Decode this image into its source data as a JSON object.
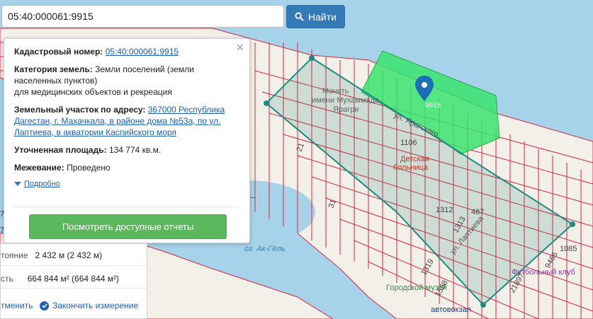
{
  "search": {
    "value": "05:40:000061:9915",
    "button_label": "Найти"
  },
  "popup": {
    "cadastral_label": "Кадастровый номер:",
    "cadastral_value": "05:40:000061:9915",
    "category_label": "Категория земель:",
    "category_value_1": "Земли поселений (земли",
    "category_value_2": "населенных пунктов)",
    "category_value_3": "для медицинских объектов и рекреация",
    "address_label": "Земельный участок по адресу:",
    "address_1": "367000 Республика",
    "address_2": "Дагестан, г. Махачкала, в районе дома №53а, по ул.",
    "address_3": "Лаптиева, в акватории Каспийского моря",
    "area_label": "Уточненная площадь:",
    "area_value": "134 774 кв.м.",
    "survey_label": "Межевание:",
    "survey_value": "Проведено",
    "more_label": "Подробно",
    "report_button": "Посмотреть доступные отчеты",
    "close_glyph": "×"
  },
  "measure": {
    "distance_label": "тояние",
    "distance_value": "2 432 м (2 432 м)",
    "area_label": "сть",
    "area_value": "664 844 м² (664 844 м²)",
    "cancel_label": "тменить",
    "finish_label": "Закончить измерение",
    "left_cut_1": "7",
    "left_cut_2": "7"
  },
  "map": {
    "marker_label": "9915",
    "labels": {
      "mosque_1": "Мечеть",
      "mosque_2": "имени Мухаммада",
      "mosque_3": "Ярагри",
      "hospital_num": "1106",
      "hospital_1": "Детская",
      "hospital_2": "больница",
      "lake": "оз. Ак-Гёль",
      "museum": "Городской музей",
      "station": "автовокзал",
      "yaragskogo_street": "ул. Ярагского",
      "lapteva_street": "ул. Лаптиева",
      "footclub": "Футбольный клуб",
      "n1312": "1312",
      "n1313": "1313",
      "n487": "487",
      "n1085": "1085",
      "n1319": "1319",
      "n1588": "1588",
      "n21897": "21897",
      "n9466": "9466",
      "n21": "21",
      "n31": "31"
    },
    "colors": {
      "water": "#a7d3ea",
      "land": "#f3f0ea",
      "parcel_line": "#d7263d",
      "selected_parcel": "#38e36e",
      "measure_poly": "#1f8a7d",
      "marker": "#1b6fb5",
      "accent_blue": "#337ab7",
      "accent_green": "#5cb85c"
    }
  }
}
